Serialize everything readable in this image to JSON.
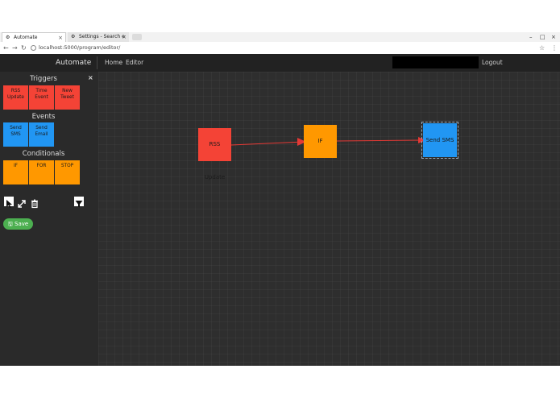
{
  "browser": {
    "tabs": [
      {
        "label": "Automate",
        "icon": "gear-icon"
      },
      {
        "label": "Settings - Search e",
        "icon": "gear-icon"
      }
    ],
    "url": "localhost:5000/program/editor/"
  },
  "header": {
    "brand": "Automate",
    "nav": [
      "Home",
      "Editor"
    ],
    "logout": "Logout"
  },
  "sidebar": {
    "sections": [
      {
        "title": "Triggers",
        "blocks": [
          "RSS\nUpdate",
          "Time\nEvent",
          "New\nTweet"
        ],
        "color": "#f44336"
      },
      {
        "title": "Events",
        "blocks": [
          "Send\nSMS",
          "Send\nEmail"
        ],
        "color": "#2196f3"
      },
      {
        "title": "Conditionals",
        "blocks": [
          "IF",
          "FOR",
          "STOP"
        ],
        "color": "#ff9800"
      }
    ],
    "save_label": "Save"
  },
  "canvas": {
    "nodes": [
      {
        "label": "RSS Update",
        "color": "#f44336"
      },
      {
        "label": "IF",
        "color": "#ff9800"
      },
      {
        "label": "Send SMS",
        "color": "#2196f3"
      }
    ],
    "connection_color": "#e53935"
  },
  "colors": {
    "accent_green": "#4caf50",
    "header_bg": "#222222",
    "canvas_bg": "#2e2e2e"
  }
}
